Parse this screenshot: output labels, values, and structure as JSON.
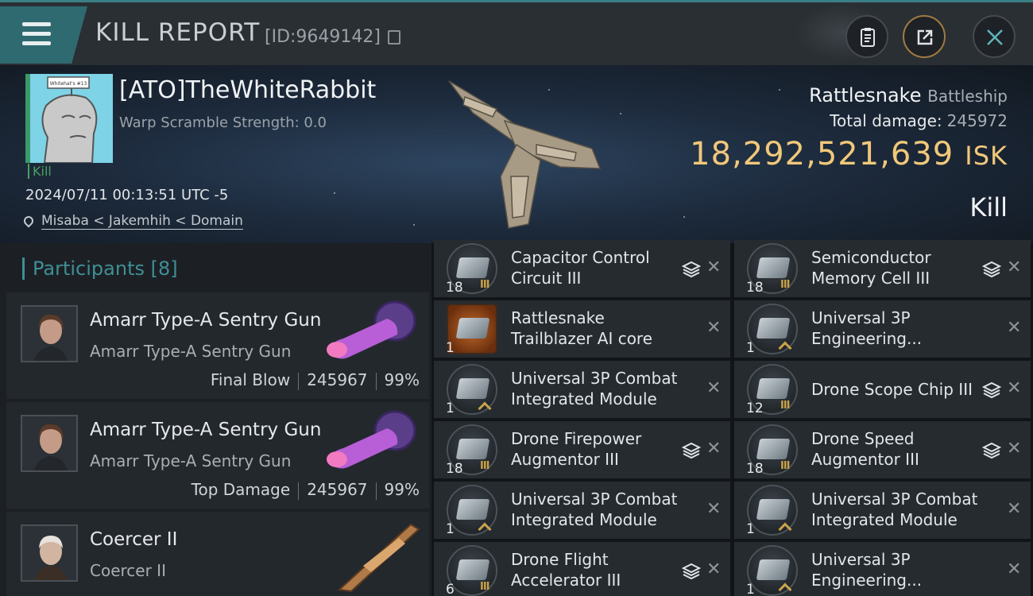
{
  "header": {
    "title": "KILL REPORT",
    "kill_id": "[ID:9649142]"
  },
  "victim": {
    "name": "[ATO]TheWhiteRabbit",
    "portrait_text": "Whitehat's #13",
    "warp_scramble": "Warp Scramble Strength: 0.0",
    "tag": "Kill",
    "datetime": "2024/07/11 00:13:51 UTC -5",
    "location": "Misaba < Jakemhih < Domain",
    "ship_name": "Rattlesnake",
    "ship_class": "Battleship",
    "total_damage_label": "Total damage:",
    "total_damage": "245972",
    "isk_value": "18,292,521,639",
    "isk_unit": "ISK",
    "result": "Kill"
  },
  "participants": {
    "label": "Participants",
    "count": "[8]",
    "rows": [
      {
        "name": "Amarr Type-A Sentry Gun",
        "ship": "Amarr Type-A Sentry Gun",
        "role": "Final Blow",
        "damage": "245967",
        "percent": "99%"
      },
      {
        "name": "Amarr Type-A Sentry Gun",
        "ship": "Amarr Type-A Sentry Gun",
        "role": "Top Damage",
        "damage": "245967",
        "percent": "99%"
      },
      {
        "name": "Coercer II",
        "ship": "Coercer II"
      }
    ]
  },
  "modules": [
    {
      "name": "Capacitor Control Circuit III",
      "qty": "18",
      "tier": "III",
      "stack": true
    },
    {
      "name": "Semiconductor Memory Cell III",
      "qty": "18",
      "tier": "III",
      "stack": true
    },
    {
      "name": "Rattlesnake Trailblazer AI core",
      "qty": "1"
    },
    {
      "name": "Universal 3P Engineering...",
      "qty": "1",
      "upgrade": true
    },
    {
      "name": "Universal 3P Combat Integrated Module",
      "qty": "1",
      "upgrade": true
    },
    {
      "name": "Drone Scope Chip III",
      "qty": "12",
      "tier": "III",
      "stack": true
    },
    {
      "name": "Drone Firepower Augmentor III",
      "qty": "18",
      "tier": "III",
      "stack": true
    },
    {
      "name": "Drone Speed Augmentor III",
      "qty": "18",
      "tier": "III",
      "stack": true
    },
    {
      "name": "Universal 3P Combat Integrated Module",
      "qty": "1",
      "upgrade": true
    },
    {
      "name": "Universal 3P Combat Integrated Module",
      "qty": "1",
      "upgrade": true
    },
    {
      "name": "Drone Flight Accelerator III",
      "qty": "6",
      "tier": "III",
      "stack": true
    },
    {
      "name": "Universal 3P Engineering...",
      "qty": "1",
      "upgrade": true
    }
  ],
  "icons": {
    "menu": "menu-icon",
    "copy": "copy-icon",
    "clipboard": "clipboard-icon",
    "share": "share-icon",
    "close": "close-icon",
    "location": "map-pin-icon",
    "stack": "layers-icon",
    "remove": "x-icon"
  },
  "colors": {
    "accent": "#3f8f95",
    "isk": "#f1c87a",
    "kill_tag": "#4aa060",
    "tier": "#c9a24a"
  }
}
